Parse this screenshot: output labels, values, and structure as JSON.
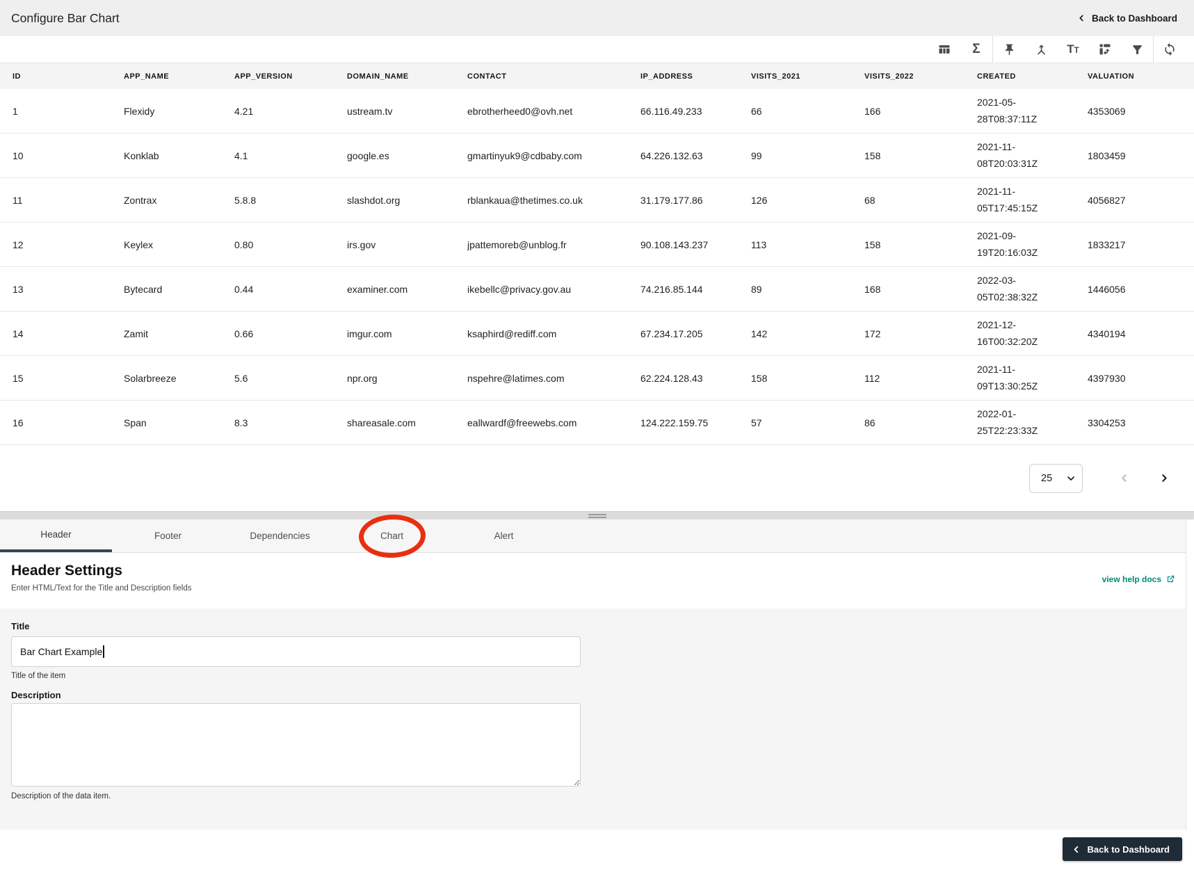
{
  "header": {
    "title": "Configure Bar Chart",
    "back_label": "Back to Dashboard"
  },
  "toolbar": {
    "icons": [
      "table-columns-icon",
      "sigma-icon",
      "pin-icon",
      "merge-icon",
      "text-format-icon",
      "pivot-table-icon",
      "filter-icon",
      "sync-icon"
    ],
    "sigma_glyph": "Σ",
    "tt_large": "T",
    "tt_small": "T"
  },
  "table": {
    "columns": [
      "ID",
      "APP_NAME",
      "APP_VERSION",
      "DOMAIN_NAME",
      "CONTACT",
      "IP_ADDRESS",
      "VISITS_2021",
      "VISITS_2022",
      "CREATED",
      "VALUATION"
    ],
    "rows": [
      [
        "1",
        "Flexidy",
        "4.21",
        "ustream.tv",
        "ebrotherheed0@ovh.net",
        "66.116.49.233",
        "66",
        "166",
        "2021-05-28T08:37:11Z",
        "4353069"
      ],
      [
        "10",
        "Konklab",
        "4.1",
        "google.es",
        "gmartinyuk9@cdbaby.com",
        "64.226.132.63",
        "99",
        "158",
        "2021-11-08T20:03:31Z",
        "1803459"
      ],
      [
        "11",
        "Zontrax",
        "5.8.8",
        "slashdot.org",
        "rblankaua@thetimes.co.uk",
        "31.179.177.86",
        "126",
        "68",
        "2021-11-05T17:45:15Z",
        "4056827"
      ],
      [
        "12",
        "Keylex",
        "0.80",
        "irs.gov",
        "jpattemoreb@unblog.fr",
        "90.108.143.237",
        "113",
        "158",
        "2021-09-19T20:16:03Z",
        "1833217"
      ],
      [
        "13",
        "Bytecard",
        "0.44",
        "examiner.com",
        "ikebellc@privacy.gov.au",
        "74.216.85.144",
        "89",
        "168",
        "2022-03-05T02:38:32Z",
        "1446056"
      ],
      [
        "14",
        "Zamit",
        "0.66",
        "imgur.com",
        "ksaphird@rediff.com",
        "67.234.17.205",
        "142",
        "172",
        "2021-12-16T00:32:20Z",
        "4340194"
      ],
      [
        "15",
        "Solarbreeze",
        "5.6",
        "npr.org",
        "nspehre@latimes.com",
        "62.224.128.43",
        "158",
        "112",
        "2021-11-09T13:30:25Z",
        "4397930"
      ],
      [
        "16",
        "Span",
        "8.3",
        "shareasale.com",
        "eallwardf@freewebs.com",
        "124.222.159.75",
        "57",
        "86",
        "2022-01-25T22:23:33Z",
        "3304253"
      ]
    ],
    "page_size": "25"
  },
  "tabs": {
    "items": [
      "Header",
      "Footer",
      "Dependencies",
      "Chart",
      "Alert"
    ],
    "active": "Header",
    "annotated": "Chart"
  },
  "settings": {
    "heading": "Header Settings",
    "subheading": "Enter HTML/Text for the Title and Description fields",
    "help_link": "view help docs",
    "title_label": "Title",
    "title_value": "Bar Chart Example",
    "title_help": "Title of the item",
    "description_label": "Description",
    "description_value": "",
    "description_help": "Description of the data item."
  },
  "footer": {
    "back_label": "Back to Dashboard"
  },
  "colors": {
    "accent_teal": "#00897b",
    "annotation_red": "#ea2f10",
    "active_tab_underline": "#30485a",
    "button_dark": "#1f2b36",
    "topbar_bg": "#efefef",
    "panel_bg": "#f5f5f5"
  }
}
